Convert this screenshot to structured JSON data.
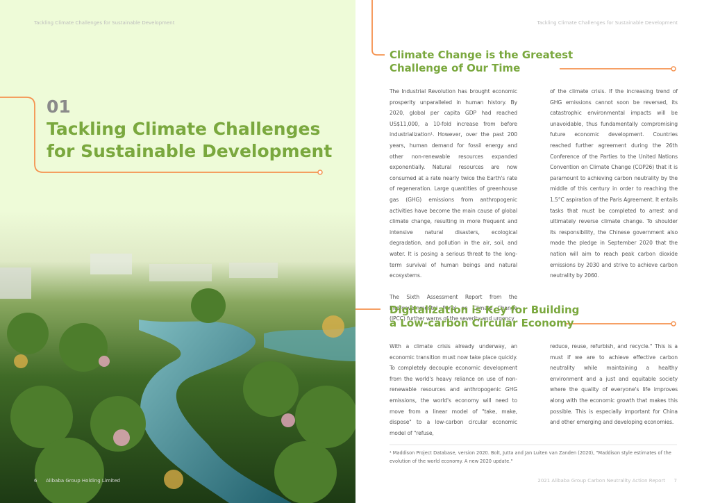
{
  "running_head": "Tackling Climate Challenges for Sustainable Development",
  "chapter": {
    "number": "01",
    "title_line1": "Tackling Climate Challenges",
    "title_line2": "for Sustainable Development"
  },
  "left_footer": {
    "page": "6",
    "company": "Alibaba Group Holding Limited"
  },
  "sections": [
    {
      "heading_line1": "Climate Change is the Greatest",
      "heading_line2": "Challenge of Our Time",
      "col1_p1": "The Industrial Revolution has brought economic prosperity unparalleled in human history. By 2020, global per capita GDP had reached US$11,000, a 10-fold increase from before industrialization¹. However, over the past 200 years, human demand for fossil energy and other non-renewable resources expanded exponentially. Natural resources are now consumed at a rate nearly twice the Earth's rate of regeneration. Large quantities of greenhouse gas (GHG) emissions from anthropogenic activities have become the main cause of global climate change, resulting in more frequent and intensive natural disasters, ecological degradation, and pollution in the air, soil, and water. It is posing a serious threat to the long-term survival of human beings and natural ecosystems.",
      "col1_p2": "The Sixth Assessment Report from the Intergovernmental Panel on Climate Change (IPCC) further warns of the severity and urgency",
      "col2": "of the climate crisis. If the increasing trend of GHG emissions cannot soon be reversed, its catastrophic environmental impacts will be unavoidable, thus fundamentally compromising future economic development. Countries reached further agreement during the 26th Conference of the Parties to the United Nations Convention on Climate Change (COP26) that it is paramount to achieving carbon neutrality by the middle of this century in order to reaching the 1.5°C aspiration of the Paris Agreement. It entails tasks that must be completed to arrest and ultimately reverse climate change. To shoulder its responsibility, the Chinese government also made the pledge in September 2020 that the nation will aim to reach peak carbon dioxide emissions by 2030 and strive to achieve carbon neutrality by 2060."
    },
    {
      "heading_line1": "Digitalization is Key for Building",
      "heading_line2": "a Low-carbon Circular Economy",
      "col1": "With a climate crisis already underway, an economic transition must now take place quickly. To completely decouple economic development from the world's heavy reliance on use of non-renewable resources and anthropogenic GHG emissions, the world's economy will need to move from a linear model of \"take, make, dispose\" to a low-carbon circular economic model of \"refuse,",
      "col2": "reduce, reuse, refurbish, and recycle.\" This is a must if we are to achieve effective carbon neutrality while maintaining a healthy environment and a just and equitable society where the quality of everyone's life improves along with the economic growth that makes this possible. This is especially important for China and other emerging and developing economies."
    }
  ],
  "footnote": "¹ Maddison Project Database, version 2020. Bolt, Jutta and Jan Luiten van Zanden (2020), \"Maddison style estimates of the evolution of the world economy. A new 2020 update.\"",
  "right_footer": {
    "report": "2021 Alibaba Group Carbon Neutrality Action Report",
    "page": "7"
  },
  "colors": {
    "green": "#7aa83e",
    "orange": "#f5924f",
    "bg_green": "#eefbd8"
  }
}
